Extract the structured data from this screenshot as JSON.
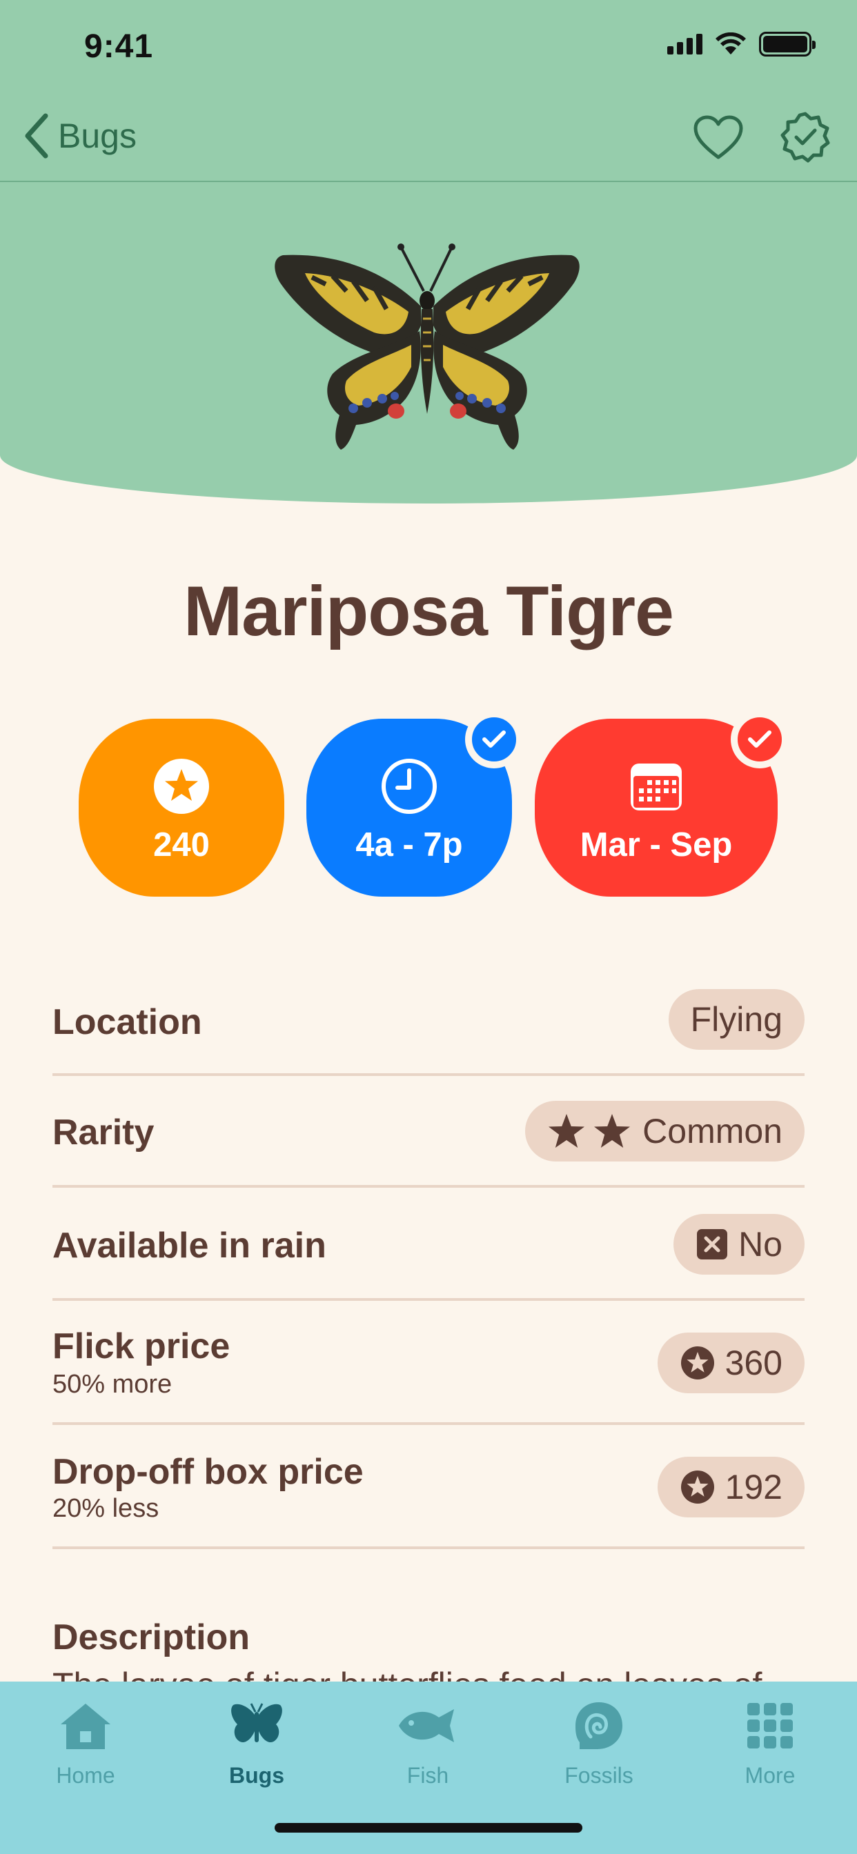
{
  "status_bar": {
    "time": "9:41"
  },
  "nav": {
    "back_label": "Bugs",
    "favorite_icon": "heart-icon",
    "caught_icon": "seal-check-icon"
  },
  "item": {
    "name": "Mariposa Tigre",
    "image": "tiger-butterfly"
  },
  "badges": {
    "price": {
      "value": "240",
      "icon": "star-coin-icon",
      "color": "#ff9500"
    },
    "time": {
      "value": "4a - 7p",
      "icon": "clock-icon",
      "color": "#0a7cff",
      "checked": true
    },
    "season": {
      "value": "Mar - Sep",
      "icon": "calendar-icon",
      "color": "#ff3b30",
      "checked": true
    }
  },
  "details": {
    "location": {
      "label": "Location",
      "value": "Flying"
    },
    "rarity": {
      "label": "Rarity",
      "value": "Common",
      "stars": 2
    },
    "rain": {
      "label": "Available in rain",
      "value": "No"
    },
    "flick_price": {
      "label": "Flick price",
      "sublabel": "50% more",
      "value": "360"
    },
    "dropoff_price": {
      "label": "Drop-off box price",
      "sublabel": "20% less",
      "value": "192"
    }
  },
  "description": {
    "heading": "Description",
    "text": "The larvae of tiger butterflies feed on leaves of"
  },
  "tabs": [
    {
      "label": "Home",
      "icon": "house-icon",
      "active": false
    },
    {
      "label": "Bugs",
      "icon": "butterfly-icon",
      "active": true
    },
    {
      "label": "Fish",
      "icon": "fish-icon",
      "active": false
    },
    {
      "label": "Fossils",
      "icon": "fossil-icon",
      "active": false
    },
    {
      "label": "More",
      "icon": "grid-icon",
      "active": false
    }
  ],
  "colors": {
    "header_green": "#96cdac",
    "nav_tint": "#2e6b4c",
    "background": "#fcf5ec",
    "text_brown": "#5b3c33",
    "pill": "#ecd5c6",
    "tab_bar": "#8fd6dd",
    "tab_active": "#1c6470",
    "tab_inactive": "#4fa0a8"
  }
}
